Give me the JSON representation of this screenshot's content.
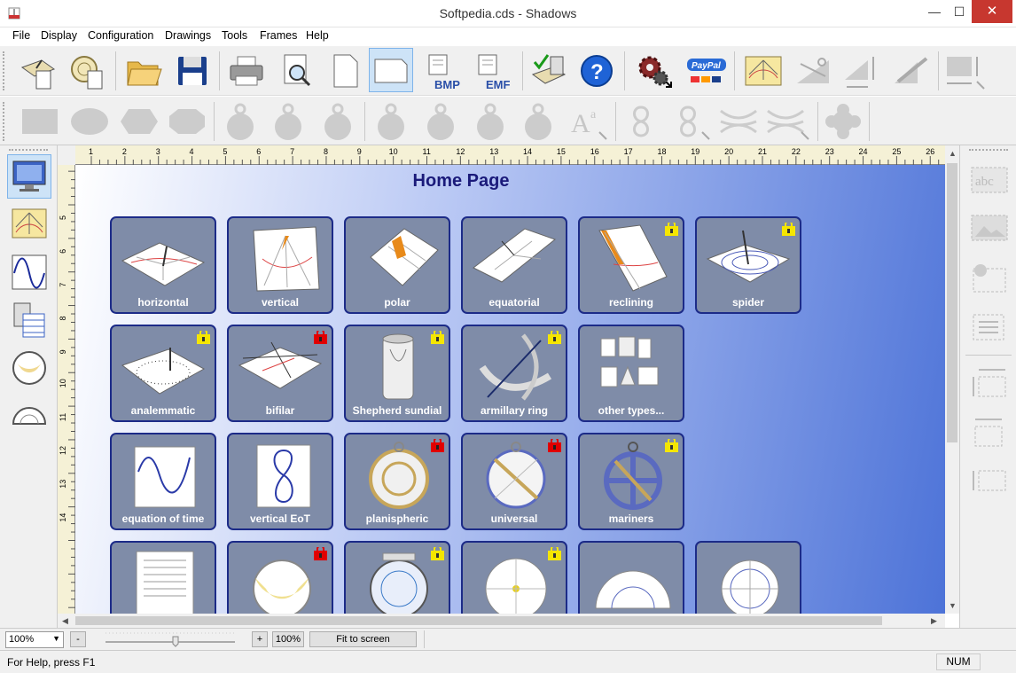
{
  "window": {
    "title": "Softpedia.cds - Shadows",
    "min": "—",
    "max": "☐",
    "close": "✕"
  },
  "menu": [
    "File",
    "Display",
    "Configuration",
    "Drawings",
    "Tools",
    "Frames",
    "Help"
  ],
  "toolbar_icons": {
    "bmp": "BMP",
    "emf": "EMF",
    "paypal": "PayPal",
    "abc": "abc"
  },
  "ruler": {
    "top": [
      "1",
      "2",
      "3",
      "4",
      "5",
      "6",
      "7",
      "8",
      "9",
      "10",
      "11",
      "12",
      "13",
      "14",
      "15",
      "16",
      "17",
      "18",
      "19",
      "20",
      "21",
      "22",
      "23",
      "24",
      "25",
      "26"
    ],
    "left": [
      "5",
      "6",
      "7",
      "8",
      "9",
      "10",
      "11",
      "12",
      "13",
      "14"
    ]
  },
  "home": {
    "title": "Home Page"
  },
  "tiles": [
    {
      "label": "horizontal",
      "lock": ""
    },
    {
      "label": "vertical",
      "lock": ""
    },
    {
      "label": "polar",
      "lock": ""
    },
    {
      "label": "equatorial",
      "lock": ""
    },
    {
      "label": "reclining",
      "lock": "yellow"
    },
    {
      "label": "spider",
      "lock": "yellow"
    },
    {
      "label": "analemmatic",
      "lock": "yellow"
    },
    {
      "label": "bifilar",
      "lock": "red"
    },
    {
      "label": "Shepherd sundial",
      "lock": "yellow"
    },
    {
      "label": "armillary ring",
      "lock": "yellow"
    },
    {
      "label": "other types...",
      "lock": ""
    },
    {
      "label": "equation of time",
      "lock": ""
    },
    {
      "label": "vertical EoT",
      "lock": ""
    },
    {
      "label": "planispheric",
      "lock": "red"
    },
    {
      "label": "universal",
      "lock": "red"
    },
    {
      "label": "mariners",
      "lock": "yellow"
    },
    {
      "label": "",
      "lock": ""
    },
    {
      "label": "",
      "lock": "red"
    },
    {
      "label": "",
      "lock": "yellow"
    },
    {
      "label": "",
      "lock": "yellow"
    },
    {
      "label": "",
      "lock": ""
    },
    {
      "label": "",
      "lock": ""
    }
  ],
  "bottom": {
    "zoom": "100%",
    "zoom_out": "-",
    "zoom_in": "+",
    "zoom_reset": "100%",
    "fit": "Fit to screen"
  },
  "status": {
    "help": "For Help, press F1",
    "num": "NUM"
  },
  "colors": {
    "accent": "#1c2b88",
    "tile_bg": "#7f8ca8",
    "canvas_end": "#4d73d8",
    "lock_yellow": "#f5e600",
    "lock_red": "#e00000"
  }
}
